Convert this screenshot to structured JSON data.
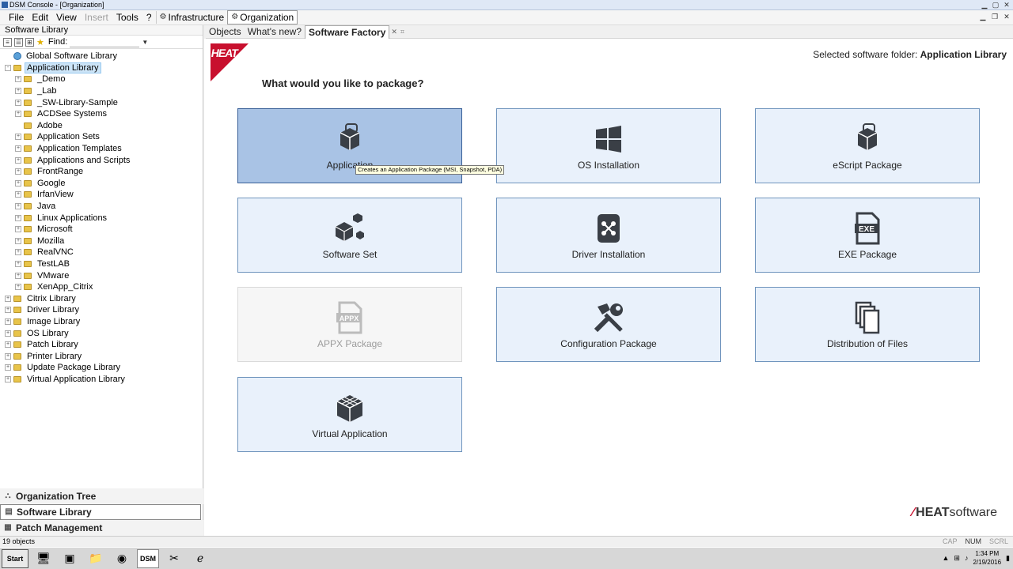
{
  "window": {
    "title": "DSM Console - [Organization]",
    "controls": [
      "minimize",
      "maximize",
      "close"
    ]
  },
  "menubar": {
    "items": [
      {
        "label": "File",
        "disabled": false
      },
      {
        "label": "Edit",
        "disabled": false
      },
      {
        "label": "View",
        "disabled": false
      },
      {
        "label": "Insert",
        "disabled": true
      },
      {
        "label": "Tools",
        "disabled": false
      },
      {
        "label": "?",
        "disabled": false
      }
    ],
    "tabs": [
      {
        "label": "Infrastructure",
        "active": false
      },
      {
        "label": "Organization",
        "active": true
      }
    ]
  },
  "left_panel": {
    "header": "Software Library",
    "find_label": "Find:",
    "find_value": "",
    "tree": [
      {
        "label": "Global Software Library",
        "level": 0,
        "expander": "",
        "icon": "globe-icon"
      },
      {
        "label": "Application Library",
        "level": 0,
        "expander": "-",
        "icon": "folder-icon",
        "selected": true
      },
      {
        "label": "_Demo",
        "level": 1,
        "expander": "+",
        "icon": "folder-icon"
      },
      {
        "label": "_Lab",
        "level": 1,
        "expander": "+",
        "icon": "folder-icon"
      },
      {
        "label": "_SW-Library-Sample",
        "level": 1,
        "expander": "+",
        "icon": "folder-icon"
      },
      {
        "label": "ACDSee Systems",
        "level": 1,
        "expander": "+",
        "icon": "folder-icon"
      },
      {
        "label": "Adobe",
        "level": 1,
        "expander": "",
        "icon": "folder-icon"
      },
      {
        "label": "Application Sets",
        "level": 1,
        "expander": "+",
        "icon": "folder-icon"
      },
      {
        "label": "Application Templates",
        "level": 1,
        "expander": "+",
        "icon": "folder-icon"
      },
      {
        "label": "Applications and Scripts",
        "level": 1,
        "expander": "+",
        "icon": "folder-icon"
      },
      {
        "label": "FrontRange",
        "level": 1,
        "expander": "+",
        "icon": "folder-icon"
      },
      {
        "label": "Google",
        "level": 1,
        "expander": "+",
        "icon": "folder-icon"
      },
      {
        "label": "IrfanView",
        "level": 1,
        "expander": "+",
        "icon": "folder-icon"
      },
      {
        "label": "Java",
        "level": 1,
        "expander": "+",
        "icon": "folder-icon"
      },
      {
        "label": "Linux Applications",
        "level": 1,
        "expander": "+",
        "icon": "folder-icon"
      },
      {
        "label": "Microsoft",
        "level": 1,
        "expander": "+",
        "icon": "folder-icon"
      },
      {
        "label": "Mozilla",
        "level": 1,
        "expander": "+",
        "icon": "folder-icon"
      },
      {
        "label": "RealVNC",
        "level": 1,
        "expander": "+",
        "icon": "folder-icon"
      },
      {
        "label": "TestLAB",
        "level": 1,
        "expander": "+",
        "icon": "folder-icon"
      },
      {
        "label": "VMware",
        "level": 1,
        "expander": "+",
        "icon": "folder-icon"
      },
      {
        "label": "XenApp_Citrix",
        "level": 1,
        "expander": "+",
        "icon": "folder-icon"
      },
      {
        "label": "Citrix Library",
        "level": 0,
        "expander": "+",
        "icon": "folder-icon"
      },
      {
        "label": "Driver Library",
        "level": 0,
        "expander": "+",
        "icon": "folder-icon"
      },
      {
        "label": "Image Library",
        "level": 0,
        "expander": "+",
        "icon": "folder-icon"
      },
      {
        "label": "OS Library",
        "level": 0,
        "expander": "+",
        "icon": "folder-icon"
      },
      {
        "label": "Patch Library",
        "level": 0,
        "expander": "+",
        "icon": "folder-icon"
      },
      {
        "label": "Printer Library",
        "level": 0,
        "expander": "+",
        "icon": "folder-icon"
      },
      {
        "label": "Update Package Library",
        "level": 0,
        "expander": "+",
        "icon": "folder-icon"
      },
      {
        "label": "Virtual Application Library",
        "level": 0,
        "expander": "+",
        "icon": "folder-icon"
      }
    ],
    "nav": [
      {
        "label": "Organization Tree",
        "icon": "org-tree-icon",
        "active": false
      },
      {
        "label": "Software Library",
        "icon": "software-library-icon",
        "active": true
      },
      {
        "label": "Patch Management",
        "icon": "patch-icon",
        "active": false
      }
    ]
  },
  "tabs": [
    {
      "label": "Objects",
      "active": false
    },
    {
      "label": "What's new?",
      "active": false
    },
    {
      "label": "Software Factory",
      "active": true
    }
  ],
  "main": {
    "logo_text": "HEAT",
    "folder_prefix": "Selected software folder:",
    "folder_name": "Application Library",
    "question": "What would you like to package?",
    "tiles": [
      {
        "label": "Application",
        "icon": "application-package-icon",
        "state": "selected"
      },
      {
        "label": "OS Installation",
        "icon": "windows-icon",
        "state": "normal"
      },
      {
        "label": "eScript Package",
        "icon": "escript-package-icon",
        "state": "normal"
      },
      {
        "label": "Software Set",
        "icon": "software-set-icon",
        "state": "normal"
      },
      {
        "label": "Driver Installation",
        "icon": "driver-icon",
        "state": "normal"
      },
      {
        "label": "EXE Package",
        "icon": "exe-file-icon",
        "state": "normal"
      },
      {
        "label": "APPX Package",
        "icon": "appx-file-icon",
        "state": "disabled"
      },
      {
        "label": "Configuration Package",
        "icon": "tools-icon",
        "state": "normal"
      },
      {
        "label": "Distribution of Files",
        "icon": "files-icon",
        "state": "normal"
      },
      {
        "label": "Virtual Application",
        "icon": "virtual-app-icon",
        "state": "normal"
      }
    ],
    "tooltip": "Creates an Application Package (MSI, Snapshot, PDA)",
    "footer_brand": "HEAT",
    "footer_word": "software"
  },
  "statusbar": {
    "count": "19 objects",
    "indicators": [
      {
        "label": "CAP",
        "on": false
      },
      {
        "label": "NUM",
        "on": true
      },
      {
        "label": "SCRL",
        "on": false
      }
    ]
  },
  "taskbar": {
    "start": "Start",
    "dsm_label": "DSM",
    "time": "1:34 PM",
    "date": "2/19/2016"
  },
  "colors": {
    "tile_bg": "#e9f1fb",
    "tile_border": "#6f94bd",
    "tile_selected": "#a9c3e5",
    "heat_red": "#c8102e"
  }
}
